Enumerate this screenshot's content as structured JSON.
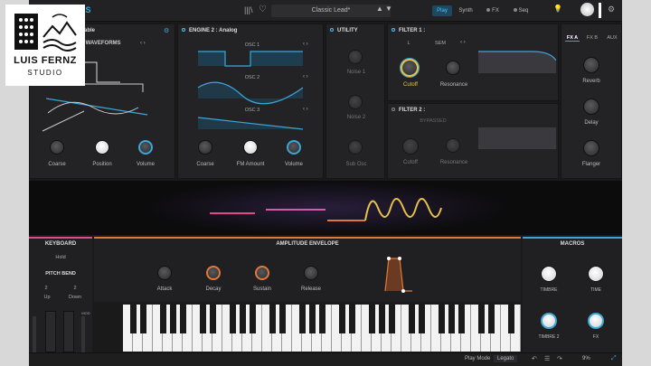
{
  "logo": {
    "line1": "LUIS FERNZ",
    "line2": "STUDIO"
  },
  "topbar": {
    "title": "TS",
    "preset": "Classic Lead*",
    "tab_play": "Play",
    "tab_synth": "Synth",
    "tab_fx": "FX",
    "tab_seq": "Seq"
  },
  "engine1": {
    "mode": "able",
    "section": "IC WAVEFORMS",
    "knobs": [
      "Coarse",
      "Position",
      "Volume"
    ]
  },
  "engine2": {
    "title": "ENGINE 2 :",
    "mode": "Analog",
    "osc": [
      "OSC 1",
      "OSC 2",
      "OSC 3"
    ],
    "knobs": [
      "Coarse",
      "FM Amount",
      "Volume"
    ]
  },
  "utility": {
    "title": "UTILITY",
    "knobs": [
      "Noise 1",
      "Noise 2",
      "Sub Osc"
    ]
  },
  "filter1": {
    "title": "FILTER 1 :",
    "type": "SEM",
    "param_l": "L",
    "knobs": [
      "Cutoff",
      "Resonance"
    ]
  },
  "filter2": {
    "title": "FILTER 2 :",
    "status": "BYPASSED",
    "knobs": [
      "Cutoff",
      "Resonance"
    ]
  },
  "fx": {
    "tabs": [
      "FX A",
      "FX B",
      "AUX"
    ],
    "knobs": [
      "Reverb",
      "Delay",
      "Flanger"
    ]
  },
  "keyboard": {
    "title": "KEYBOARD",
    "hold": "Hold",
    "pitch_bend": "PITCH BEND",
    "up_val": "2",
    "down_val": "2",
    "up": "Up",
    "down": "Down",
    "mod": "MOD"
  },
  "envelope": {
    "title": "AMPLITUDE ENVELOPE",
    "knobs": [
      "Attack",
      "Decay",
      "Sustain",
      "Release"
    ]
  },
  "macros": {
    "title": "MACROS",
    "knobs": [
      "TIMBRE",
      "TIME",
      "TIMBRE 2",
      "FX"
    ]
  },
  "status": {
    "play_mode_label": "Play Mode",
    "play_mode_value": "Legato",
    "cpu": "9%"
  },
  "colors": {
    "accent": "#3aa7d8",
    "orange": "#e0793a",
    "yellow": "#e6c24a",
    "pink": "#e04a8a"
  }
}
